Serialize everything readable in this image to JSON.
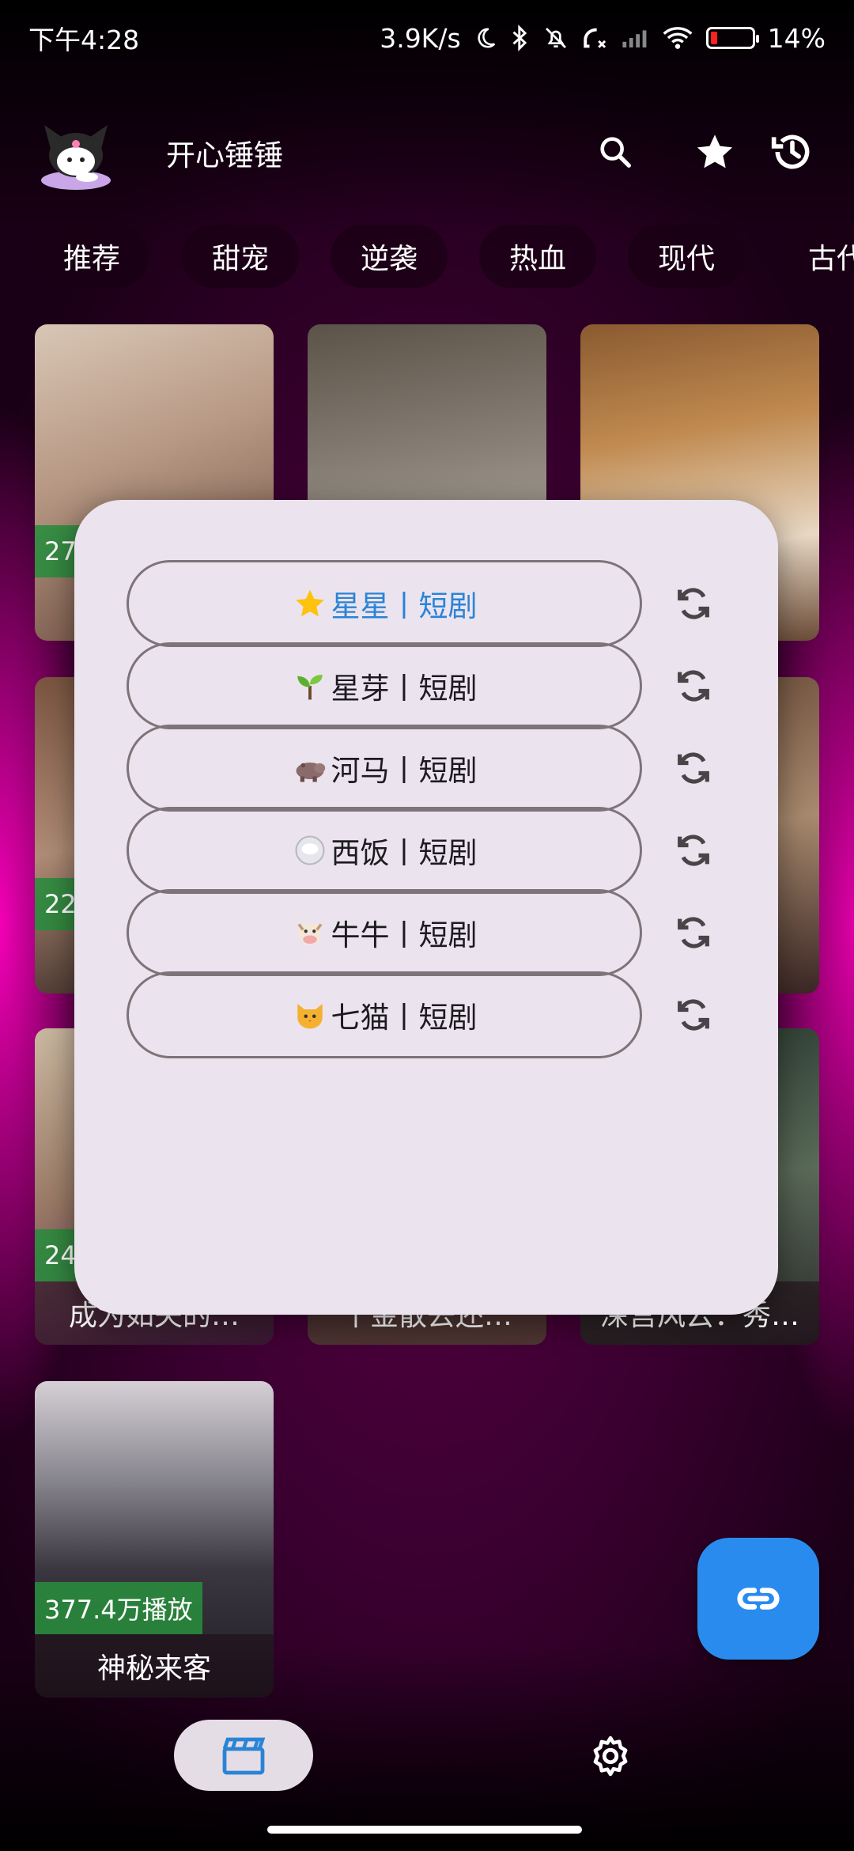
{
  "status_bar": {
    "time": "下午4:28",
    "net_speed": "3.9K/s",
    "battery": "14%",
    "battery_level": 0.14
  },
  "header": {
    "title": "开心锤锤",
    "avatar_icon": "kuromi-avatar",
    "actions": [
      "search-icon",
      "star-icon",
      "history-icon"
    ]
  },
  "tabs": [
    "推荐",
    "甜宠",
    "逆袭",
    "热血",
    "现代",
    "古代"
  ],
  "cards": [
    {
      "plays": "27",
      "title": ""
    },
    {
      "plays": "",
      "title": ""
    },
    {
      "plays": "",
      "title": ""
    },
    {
      "plays": "22",
      "title": ""
    },
    {
      "plays": "",
      "title": ""
    },
    {
      "plays": "",
      "title": ""
    },
    {
      "plays": "24",
      "title": "成为如夫的…"
    },
    {
      "plays": "",
      "title": "千金散去还…"
    },
    {
      "plays": "",
      "title": "深宫风云：秀…"
    },
    {
      "plays": "377.4万播放",
      "title": "神秘来客"
    }
  ],
  "dialog": {
    "sources": [
      {
        "emoji": "⭐",
        "label": "星星丨短剧",
        "active": true
      },
      {
        "emoji": "🌱",
        "label": "星芽丨短剧",
        "active": false
      },
      {
        "emoji": "🦛",
        "label": "河马丨短剧",
        "active": false
      },
      {
        "emoji": "🍚",
        "label": "西饭丨短剧",
        "active": false
      },
      {
        "emoji": "🐮",
        "label": "牛牛丨短剧",
        "active": false
      },
      {
        "emoji": "🐱",
        "label": "七猫丨短剧",
        "active": false
      }
    ]
  },
  "fab": {
    "icon": "link-icon"
  },
  "bottom_nav": {
    "items": [
      "clapperboard-icon",
      "gear-icon"
    ]
  },
  "colors": {
    "accent": "#2a8bef",
    "active_source": "#2a84d6",
    "play_badge": "#2f8c3c",
    "dialog_bg": "#ebe4ee"
  }
}
